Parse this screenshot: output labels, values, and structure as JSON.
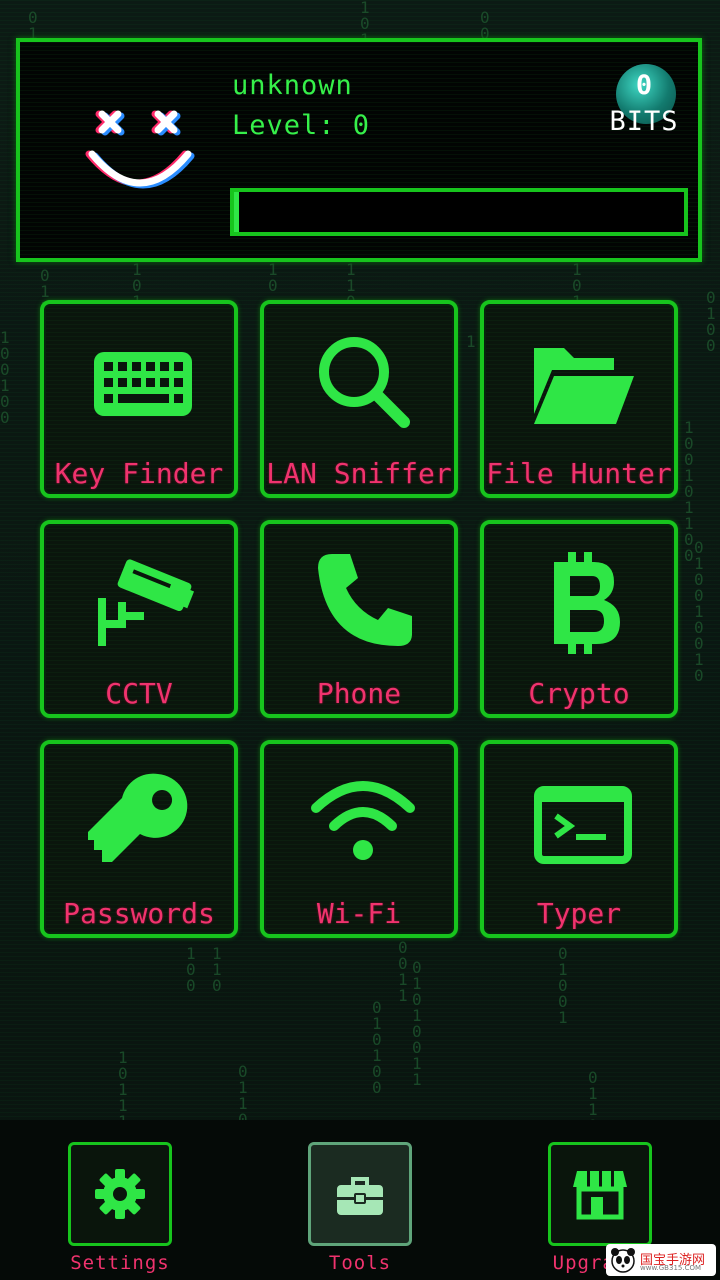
{
  "profile": {
    "username": "unknown",
    "level_label": "Level: 0",
    "bits_value": "0",
    "bits_label": "BITS",
    "xp_progress": 0.01
  },
  "tools": [
    {
      "label": "Key Finder",
      "icon": "keyboard-icon"
    },
    {
      "label": "LAN Sniffer",
      "icon": "magnifier-icon"
    },
    {
      "label": "File Hunter",
      "icon": "folder-open-icon"
    },
    {
      "label": "CCTV",
      "icon": "cctv-camera-icon"
    },
    {
      "label": "Phone",
      "icon": "phone-icon"
    },
    {
      "label": "Crypto",
      "icon": "bitcoin-icon"
    },
    {
      "label": "Passwords",
      "icon": "key-icon"
    },
    {
      "label": "Wi-Fi",
      "icon": "wifi-icon"
    },
    {
      "label": "Typer",
      "icon": "terminal-icon"
    }
  ],
  "nav": [
    {
      "label": "Settings",
      "icon": "gear-icon",
      "active": false
    },
    {
      "label": "Tools",
      "icon": "toolbox-icon",
      "active": true
    },
    {
      "label": "Upgrad",
      "icon": "shop-icon",
      "active": false
    }
  ],
  "watermark": {
    "text": "国宝手游网",
    "sub": "www.GB315.COM"
  },
  "colors": {
    "accent": "#17c41d",
    "icon": "#2fe646",
    "label": "#f0336e",
    "background": "#0a1410"
  }
}
